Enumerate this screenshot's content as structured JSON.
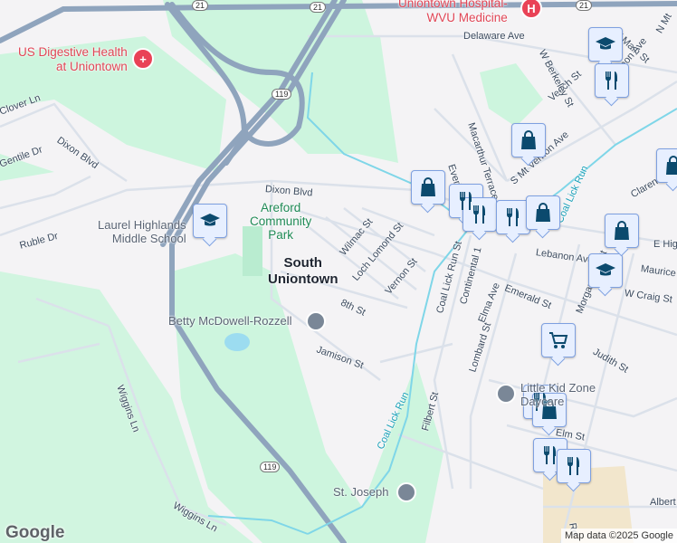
{
  "map": {
    "colors": {
      "background": "#f4f3f5",
      "park": "#cdf5de",
      "highway": "#8fa4bd",
      "water": "#7fd6e8",
      "poi": "#0b4a6e",
      "hospital": "#e94256"
    },
    "places": {
      "hospital_top": "Uniontown Hospital-",
      "hospital_bottom": "WVU Medicine",
      "digestive_1": "US Digestive Health",
      "digestive_2": "at Uniontown",
      "park_1": "Areford",
      "park_2": "Community",
      "park_3": "Park",
      "school_1": "Laurel Highlands",
      "school_2": "Middle School",
      "town_1": "South",
      "town_2": "Uniontown",
      "betty": "Betty McDowell-Rozzell",
      "kidzone_1": "Little Kid Zone",
      "kidzone_2": "Daycare",
      "stjoseph": "St. Joseph"
    },
    "streets": {
      "delaware": "Delaware Ave",
      "clover": "Clover Ln",
      "dixon1": "Dixon Blvd",
      "dixon2": "Dixon Blvd",
      "gentile": "Gentile Dr",
      "ruble": "Ruble Dr",
      "wilmac": "Wilmac St",
      "lochlomond": "Loch Lomond St",
      "vernon": "Vernon St",
      "eighth": "8th St",
      "jamison": "Jamison St",
      "wiggins1": "Wiggins Ln",
      "wiggins2": "Wiggins Ln",
      "macarthur": "Macarthur Terrace",
      "everhart": "Everhart Dr",
      "smtvernon": "S Mt Vernon Ave",
      "veech": "Veech St",
      "wberkeley": "W Berkeley St",
      "wmain": "W Main St",
      "nmt": "N Mt",
      "smtvernon2": "S Mt Vernon Ave",
      "lebanon": "Lebanon Ave",
      "ehigh": "E High",
      "maurice": "Maurice",
      "wcraig": "W Craig St",
      "morgantown": "Morgantown St",
      "coallickrunst": "Coal Lick Run St",
      "continental": "Continental 1",
      "elma": "Elma Ave",
      "emerald": "Emerald St",
      "lombard": "Lombard St",
      "judith": "Judith St",
      "filbert": "Filbert St",
      "elm": "Elm St",
      "albert": "Albert",
      "clarendon": "Clarendon",
      "rd": "Rd",
      "creek1": "Coal Lick Run",
      "creek2": "Coal Lick Run"
    },
    "shields": {
      "us21a": "21",
      "us21b": "21",
      "us21c": "21",
      "us119a": "119",
      "us119b": "119"
    },
    "pins": [
      {
        "icon": "school"
      },
      {
        "icon": "school"
      },
      {
        "icon": "school"
      },
      {
        "icon": "restaurant"
      },
      {
        "icon": "restaurant"
      },
      {
        "icon": "restaurant"
      },
      {
        "icon": "restaurant"
      },
      {
        "icon": "restaurant"
      },
      {
        "icon": "restaurant"
      },
      {
        "icon": "restaurant"
      },
      {
        "icon": "shopping"
      },
      {
        "icon": "shopping"
      },
      {
        "icon": "shopping"
      },
      {
        "icon": "shopping"
      },
      {
        "icon": "shopping"
      },
      {
        "icon": "shopping"
      },
      {
        "icon": "grocery"
      }
    ],
    "logo": "Google",
    "attribution": "Map data ©2025 Google"
  }
}
